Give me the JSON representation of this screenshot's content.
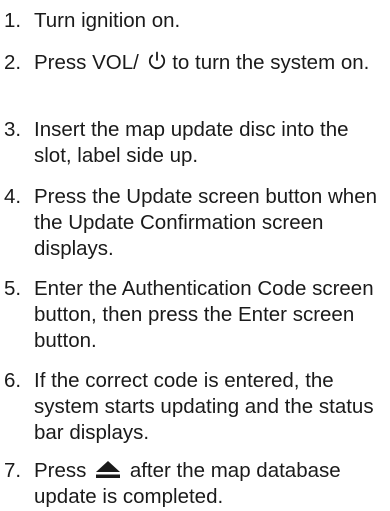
{
  "steps": [
    {
      "number": "1.",
      "text": "Turn ignition on."
    },
    {
      "number": "2.",
      "text_before": "Press VOL/",
      "icon": "power-icon",
      "text_after": " to turn the system on."
    },
    {
      "number": "3.",
      "text": "Insert the map update disc into the slot, label side up."
    },
    {
      "number": "4.",
      "text": "Press the Update screen button when the Update Confirmation screen displays."
    },
    {
      "number": "5.",
      "text": "Enter the Authentication Code screen button, then press the Enter screen button."
    },
    {
      "number": "6.",
      "text": "If the correct code is entered, the system starts updating and the status bar displays."
    },
    {
      "number": "7.",
      "text_before": "Press",
      "icon": "eject-icon",
      "text_after": "after the map database update is completed."
    }
  ]
}
